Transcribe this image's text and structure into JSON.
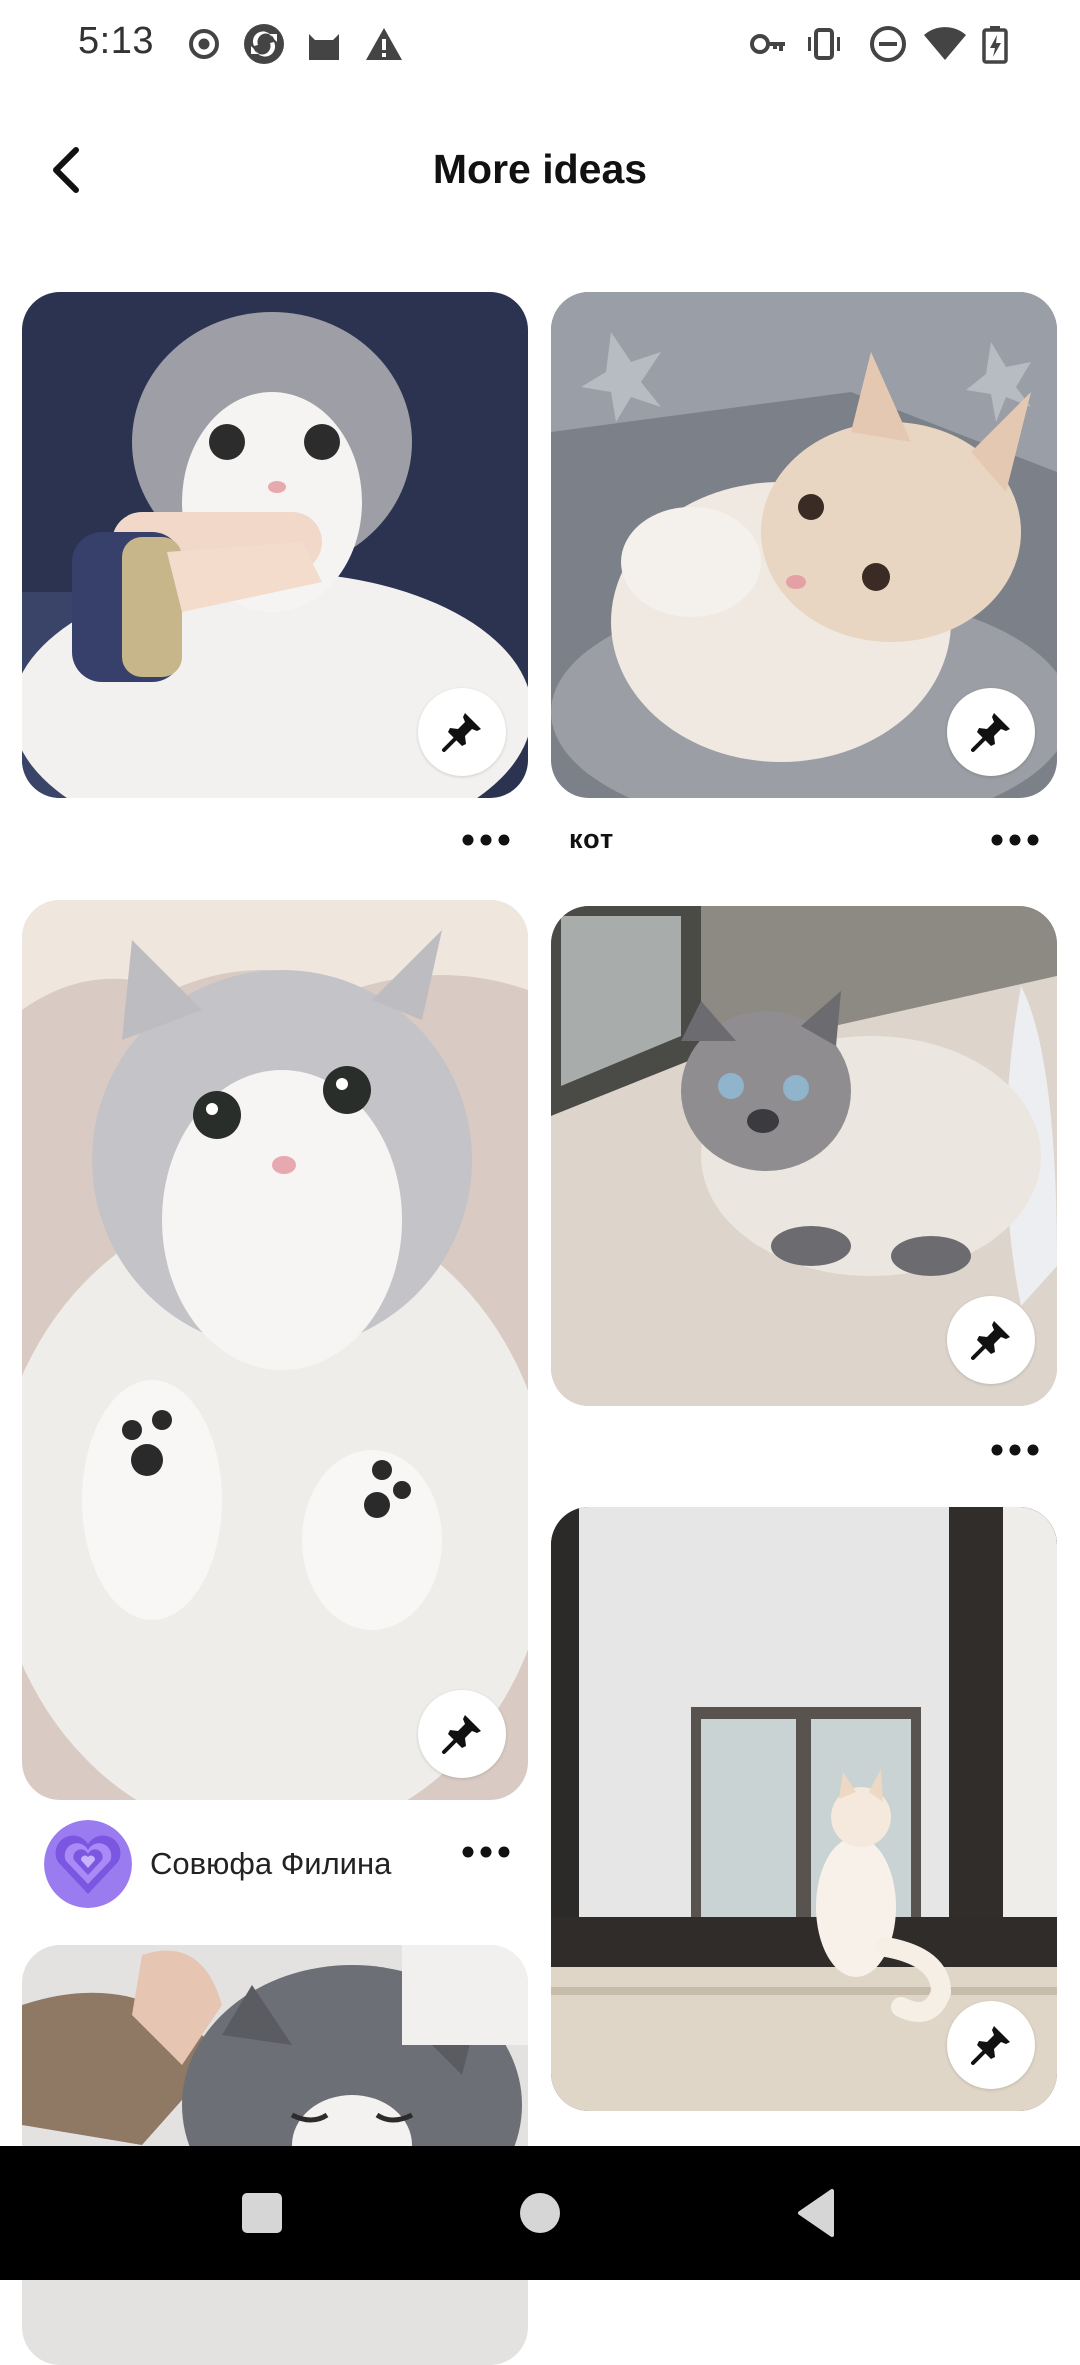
{
  "status_bar": {
    "time": "5:13",
    "left_icons": [
      "record-icon",
      "sync-icon",
      "cat-icon",
      "warning-icon"
    ],
    "right_icons": [
      "vpn-key-icon",
      "vibrate-icon",
      "do-not-disturb-icon",
      "wifi-icon",
      "battery-charging-icon"
    ]
  },
  "header": {
    "title": "More ideas",
    "back_icon": "chevron-left-icon"
  },
  "pins": [
    {
      "caption": "",
      "image": "grey-white-kitten-held-by-hand",
      "save_icon": "pushpin-icon",
      "more_icon": "more-horizontal-icon"
    },
    {
      "caption": "кот",
      "image": "cream-kitten-on-grey-blanket",
      "save_icon": "pushpin-icon",
      "more_icon": "more-horizontal-icon"
    },
    {
      "caption": "",
      "image": "fluffy-white-kitten-paws-up",
      "save_icon": "pushpin-icon",
      "more_icon": "more-horizontal-icon",
      "creator": {
        "name": "Совюфа Филина",
        "avatar": "purple-heart-avatar"
      }
    },
    {
      "caption": "",
      "image": "siamese-cat-on-floor",
      "save_icon": "pushpin-icon",
      "more_icon": "more-horizontal-icon"
    },
    {
      "caption": "",
      "image": "white-kitten-at-window",
      "save_icon": "pushpin-icon",
      "more_icon": "more-horizontal-icon"
    },
    {
      "caption": "",
      "image": "grey-kitten-sleeping",
      "save_icon": "pushpin-icon",
      "more_icon": "more-horizontal-icon"
    }
  ],
  "nav_bar": {
    "buttons": [
      "recents-square-icon",
      "home-circle-icon",
      "back-triangle-icon"
    ]
  },
  "colors": {
    "background": "#ffffff",
    "text": "#111111",
    "nav_bar": "#000000",
    "avatar_purple": "#8e6ee6"
  }
}
